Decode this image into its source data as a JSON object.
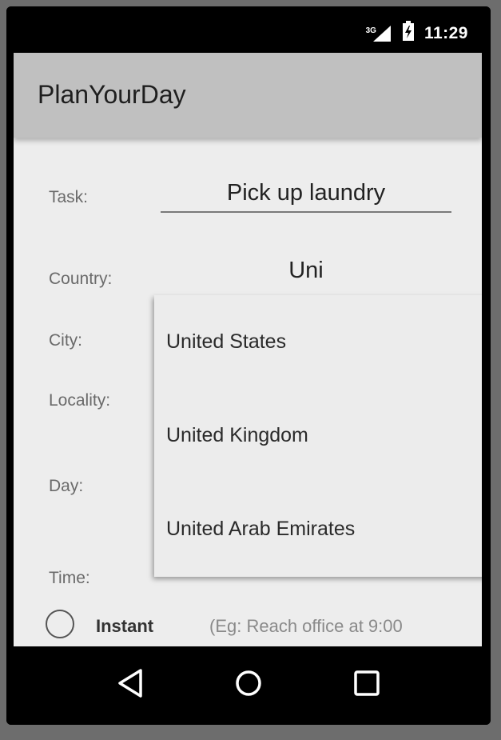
{
  "status_bar": {
    "network_label": "3G",
    "time": "11:29"
  },
  "app": {
    "title": "PlanYourDay"
  },
  "form": {
    "task_label": "Task:",
    "task_value": "Pick up laundry",
    "country_label": "Country:",
    "country_value": "Uni",
    "city_label": "City:",
    "locality_label": "Locality:",
    "day_label": "Day:",
    "time_label": "Time:",
    "radio_instant_label": "Instant",
    "radio_instant_hint": "(Eg: Reach office at 9:00"
  },
  "dropdown": {
    "items": [
      "United States",
      "United Kingdom",
      "United Arab Emirates"
    ]
  },
  "nav": {
    "icons": [
      "back-icon",
      "home-icon",
      "recents-icon"
    ]
  }
}
